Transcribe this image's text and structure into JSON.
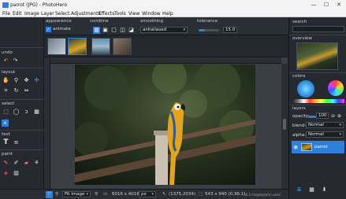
{
  "window": {
    "title": "parrot (JPG) - PhotoHero",
    "minimize": "—",
    "maximize": "☐",
    "close": "✕"
  },
  "menu": [
    "File",
    "Edit",
    "Image",
    "Layer",
    "Select",
    "Adjustments",
    "Effects",
    "Tools",
    "View",
    "Window",
    "Help"
  ],
  "options": {
    "file_label": "file",
    "appearance_label": "appearance",
    "animate_label": "animate",
    "combine_label": "combine",
    "smoothing_label": "smoothing",
    "smoothing_value": "antialiased",
    "tolerance_label": "tolerance",
    "tolerance_value": "15.0",
    "tolerance_fraction": 0.3
  },
  "left_panel": {
    "undo_label": "undo",
    "layout_label": "layout",
    "select_label": "select",
    "text_label": "text",
    "paint_label": "paint"
  },
  "right_panel": {
    "search_label": "search",
    "search_placeholder": "",
    "overview_label": "overview",
    "colors_label": "colors",
    "layers_label": "layers",
    "opacity_label": "opacity:",
    "opacity_value": "100",
    "blend_label": "blend:",
    "blend_value": "Normal",
    "alpha_label": "alpha:",
    "alpha_value": "Normal",
    "layer_name": "parrot",
    "accent": "#2f7fd8"
  },
  "status": {
    "zoom_mode": "Fit image",
    "image_size": "6016 x 4016",
    "unit": "px",
    "cursor": "(1375,2034)",
    "selection": "543 x 940 (0.36:1)",
    "memory_note": "16.3 megabyte(s) used"
  }
}
